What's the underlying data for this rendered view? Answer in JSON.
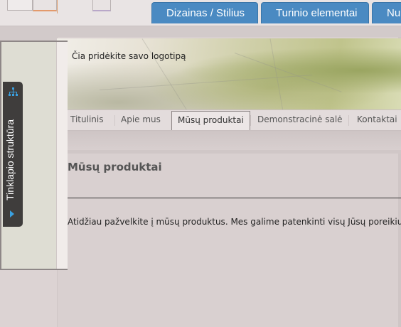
{
  "editor_tabs": [
    "Dizainas / Stilius",
    "Turinio elementai",
    "Nu"
  ],
  "header": {
    "logo_placeholder": "Čia pridėkite savo logotipą"
  },
  "nav": {
    "items": [
      {
        "label": "Titulinis"
      },
      {
        "label": "Apie mus"
      },
      {
        "label": "Mūsų produktai",
        "active": true
      },
      {
        "label": "Demonstracinė salė"
      },
      {
        "label": "Kontaktai"
      }
    ]
  },
  "content": {
    "title": "Mūsų produktai",
    "text": "Atidžiau pažvelkite į mūsų produktus. Mes galime patenkinti visų Jūsų poreikius!"
  },
  "sidebar": {
    "label": "Tinklapio struktūra"
  },
  "colors": {
    "accent_tab": "#4a8ac2",
    "dock_bg": "#3f3d3c",
    "dock_icon": "#3aa0e0"
  }
}
